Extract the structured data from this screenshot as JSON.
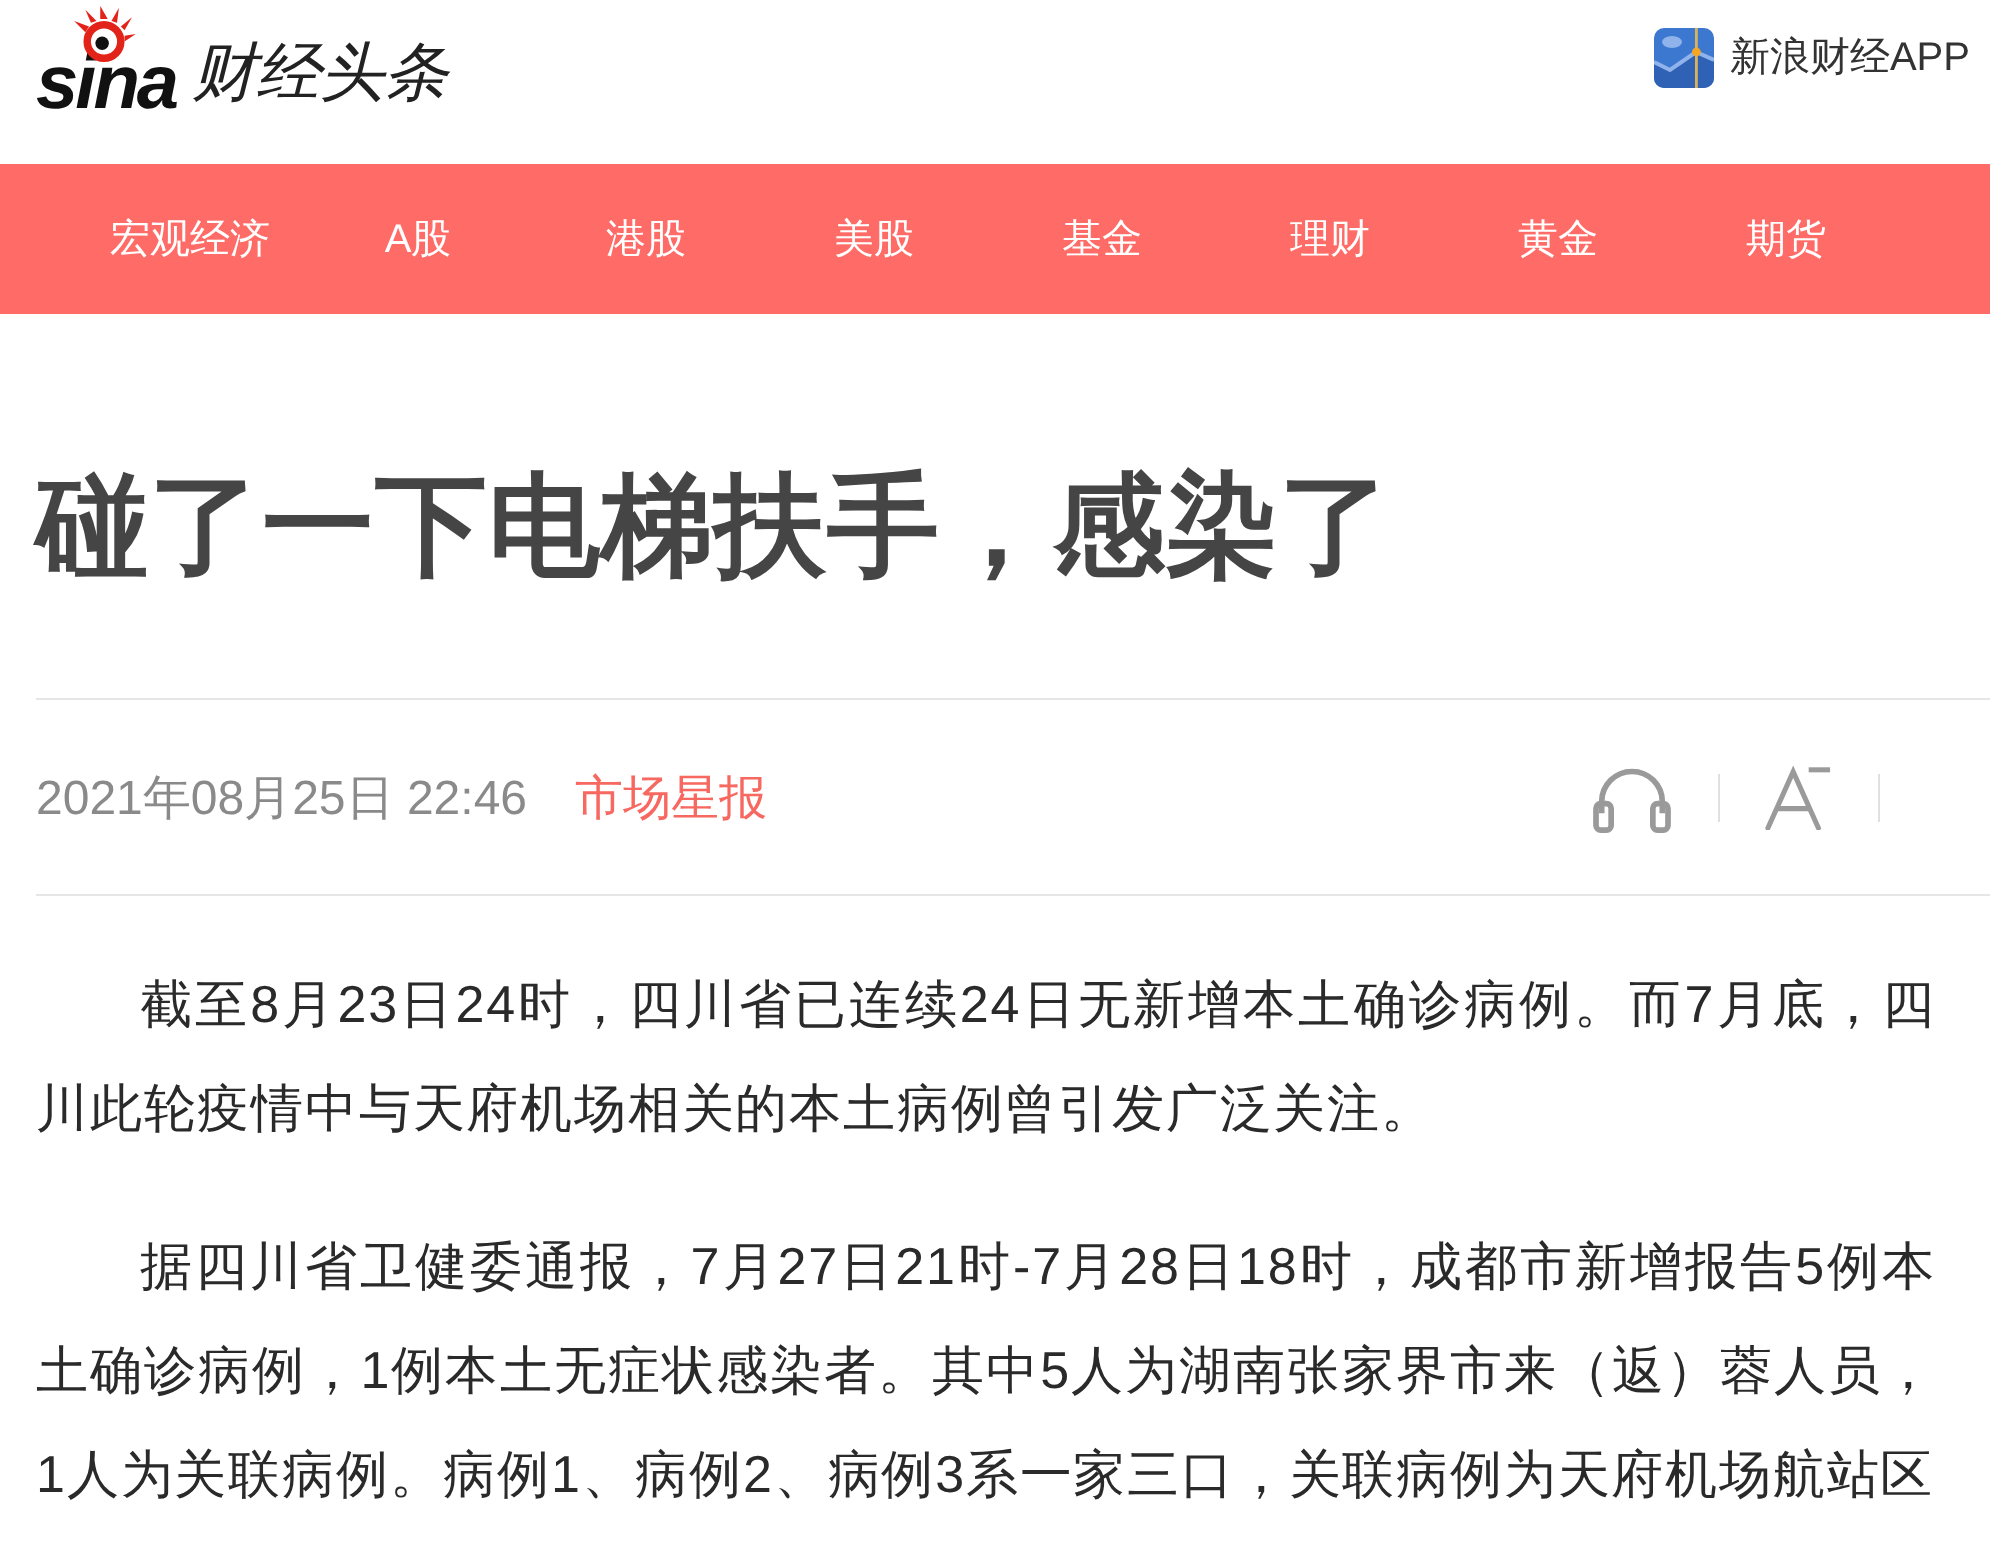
{
  "header": {
    "logo": {
      "brand": "sina",
      "section": "财经头条"
    },
    "app_link": "新浪财经APP"
  },
  "nav": [
    "宏观经济",
    "A股",
    "港股",
    "美股",
    "基金",
    "理财",
    "黄金",
    "期货"
  ],
  "article": {
    "title": "碰了一下电梯扶手，感染了",
    "date": "2021年08月25日 22:46",
    "source": "市场星报",
    "paragraphs": [
      "截至8月23日24时，四川省已连续24日无新增本土确诊病例。而7月底，四川此轮疫情中与天府机场相关的本土病例曾引发广泛关注。",
      "据四川省卫健委通报，7月27日21时-7月28日18时，成都市新增报告5例本土确诊病例，1例本土无症状感染者。其中5人为湖南张家界市来（返）蓉人员，1人为关联病例。病例1、病例2、病例3系一家三口，关联病例为天府机场航站区"
    ]
  }
}
